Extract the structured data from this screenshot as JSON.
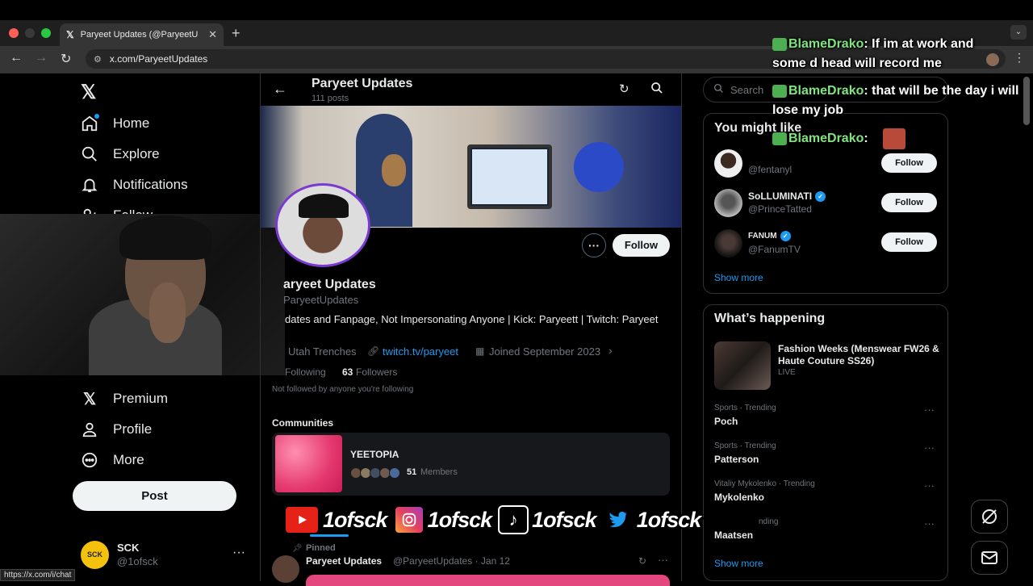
{
  "browser": {
    "tab_title": "Paryeet Updates (@ParyeetU",
    "url": "x.com/ParyeetUpdates",
    "status_url": "https://x.com/i/chat"
  },
  "nav": {
    "items": [
      {
        "label": "Home",
        "icon": "home-icon"
      },
      {
        "label": "Explore",
        "icon": "search-icon"
      },
      {
        "label": "Notifications",
        "icon": "bell-icon"
      },
      {
        "label": "Follow",
        "icon": "follow-icon"
      },
      {
        "label": "Premium",
        "icon": "x-logo-icon"
      },
      {
        "label": "Profile",
        "icon": "person-icon"
      },
      {
        "label": "More",
        "icon": "more-circle-icon"
      }
    ],
    "post_label": "Post"
  },
  "account": {
    "name": "SCK",
    "handle": "@1ofsck",
    "avatar_text": "SCK"
  },
  "profile": {
    "header_name": "Paryeet Updates",
    "posts_count": "111 posts",
    "name": "aryeet Updates",
    "handle": "ParyeetUpdates",
    "bio": "dates and Fanpage, Not Impersonating Anyone | Kick: Paryeett | Twitch: Paryeet",
    "location": "Utah Trenches",
    "link": "twitch.tv/paryeet",
    "joined": "Joined September 2023",
    "following_label": "Following",
    "followers_count": "63",
    "followers_label": "Followers",
    "not_followed": "Not followed by anyone you're following",
    "follow_label": "Follow",
    "more_label": "···"
  },
  "communities": {
    "heading": "Communities",
    "name": "YEETOPIA",
    "member_count": "51",
    "members_label": "Members"
  },
  "pinned_post": {
    "pinned_label": "Pinned",
    "author": "Paryeet Updates",
    "handle_date": "@ParyeetUpdates · Jan 12"
  },
  "right": {
    "search_placeholder": "Search",
    "suggestions_heading": "You might like",
    "suggestions": [
      {
        "name": "",
        "handle": "@fentanyl",
        "verified": false,
        "follow": "Follow"
      },
      {
        "name": "SoLLUMINATI",
        "handle": "@PrinceTatted",
        "verified": true,
        "follow": "Follow"
      },
      {
        "name": "FANUM",
        "handle": "@FanumTV",
        "verified": true,
        "follow": "Follow"
      }
    ],
    "show_more": "Show more",
    "happening_heading": "What’s happening",
    "featured": {
      "title": "Fashion Weeks (Menswear FW26 & Haute Couture SS26)",
      "status": "LIVE"
    },
    "trends": [
      {
        "meta": "Sports · Trending",
        "name": "Poch"
      },
      {
        "meta": "Sports · Trending",
        "name": "Patterson"
      },
      {
        "meta": "Vitaliy Mykolenko · Trending",
        "name": "Mykolenko"
      },
      {
        "meta": "nding",
        "name": "Maatsen"
      }
    ]
  },
  "chat": [
    {
      "user": "BlameDrako",
      "message": "If im at work and some d head will record me"
    },
    {
      "user": "BlameDrako",
      "message": "that will be the day i will lose my job"
    },
    {
      "user": "BlameDrako",
      "message": ""
    }
  ],
  "social": {
    "handle": "1ofsck",
    "platforms": [
      "youtube-icon",
      "instagram-icon",
      "tiktok-icon",
      "twitter-icon"
    ]
  },
  "colors": {
    "accent": "#1d9bf0",
    "background": "#000000",
    "muted": "#71767b",
    "chat_user": "#7fe57f"
  }
}
